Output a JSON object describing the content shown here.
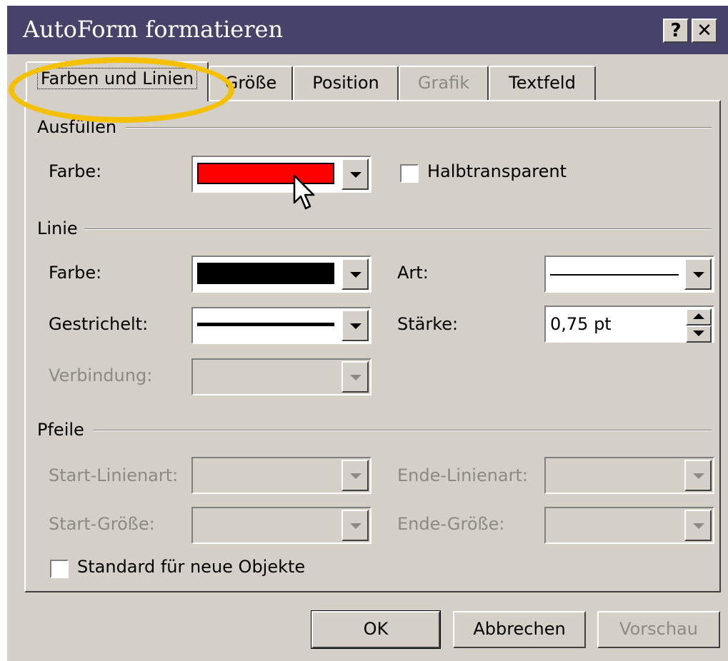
{
  "window": {
    "title": "AutoForm formatieren",
    "help_glyph": "?",
    "close_glyph": "✕"
  },
  "tabs": [
    {
      "label": "Farben und Linien",
      "active": true
    },
    {
      "label": "Größe",
      "active": false
    },
    {
      "label": "Position",
      "active": false
    },
    {
      "label": "Grafik",
      "active": false,
      "disabled": true
    },
    {
      "label": "Textfeld",
      "active": false
    }
  ],
  "fill": {
    "section": "Ausfüllen",
    "color_label": "Farbe:",
    "color_value": "#ff0000",
    "semitransparent_label": "Halbtransparent",
    "semitransparent_checked": false
  },
  "line": {
    "section": "Linie",
    "color_label": "Farbe:",
    "color_value": "#000000",
    "style_label": "Art:",
    "dashed_label": "Gestrichelt:",
    "weight_label": "Stärke:",
    "weight_value": "0,75 pt",
    "connector_label": "Verbindung:"
  },
  "arrows": {
    "section": "Pfeile",
    "start_style_label": "Start-Linienart:",
    "end_style_label": "Ende-Linienart:",
    "start_size_label": "Start-Größe:",
    "end_size_label": "Ende-Größe:"
  },
  "default_checkbox": {
    "label": "Standard für neue Objekte",
    "checked": false
  },
  "buttons": {
    "ok": "OK",
    "cancel": "Abbrechen",
    "preview": "Vorschau"
  },
  "colors": {
    "titlebar": "#47426a",
    "dialog_face": "#d4d0c8",
    "highlight_ring": "#f5c000",
    "disabled_text": "#8c8a85"
  }
}
